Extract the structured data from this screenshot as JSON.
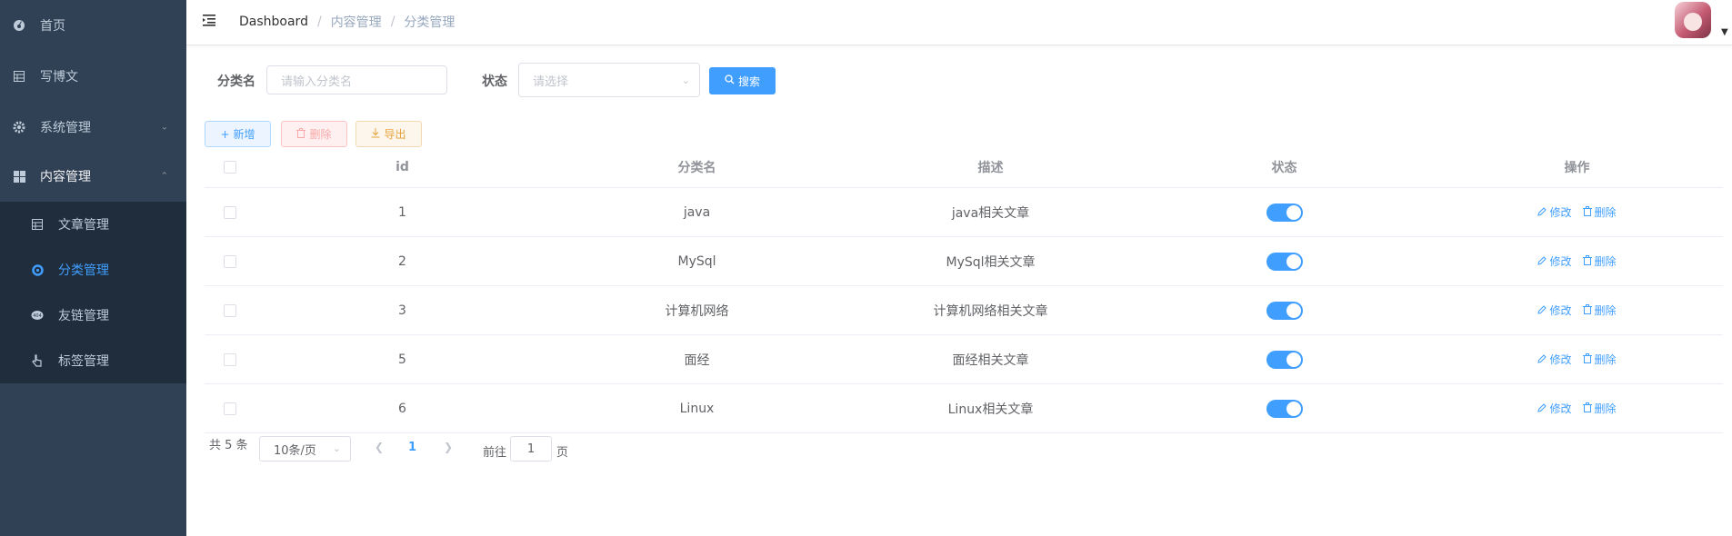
{
  "sidebar": {
    "items": [
      {
        "label": "首页",
        "icon": "dashboard-icon"
      },
      {
        "label": "写博文",
        "icon": "table-icon"
      },
      {
        "label": "系统管理",
        "icon": "gear-icon"
      },
      {
        "label": "内容管理",
        "icon": "grid-icon"
      }
    ],
    "sub_items": [
      {
        "label": "文章管理",
        "icon": "table-icon"
      },
      {
        "label": "分类管理",
        "icon": "category-icon",
        "active": true
      },
      {
        "label": "友链管理",
        "icon": "link-icon"
      },
      {
        "label": "标签管理",
        "icon": "pointer-icon"
      }
    ],
    "colors": {
      "bg": "#304156",
      "sub_bg": "#1f2d3d",
      "active": "#409eff"
    }
  },
  "header": {
    "breadcrumb": [
      "Dashboard",
      "内容管理",
      "分类管理"
    ],
    "separator": "/"
  },
  "search": {
    "name_label": "分类名",
    "name_placeholder": "请输入分类名",
    "status_label": "状态",
    "status_placeholder": "请选择",
    "search_button": "搜索"
  },
  "actions": {
    "add": "新增",
    "delete": "删除",
    "export": "导出"
  },
  "table": {
    "columns": [
      "id",
      "分类名",
      "描述",
      "状态",
      "操作"
    ],
    "rows": [
      {
        "id": "1",
        "name": "java",
        "desc": "java相关文章",
        "enabled": true
      },
      {
        "id": "2",
        "name": "MySql",
        "desc": "MySql相关文章",
        "enabled": true
      },
      {
        "id": "3",
        "name": "计算机网络",
        "desc": "计算机网络相关文章",
        "enabled": true
      },
      {
        "id": "5",
        "name": "面经",
        "desc": "面经相关文章",
        "enabled": true
      },
      {
        "id": "6",
        "name": "Linux",
        "desc": "Linux相关文章",
        "enabled": true
      }
    ],
    "edit_label": "修改",
    "delete_label": "删除"
  },
  "pagination": {
    "total_text": "共 5 条",
    "page_size": "10条/页",
    "current_page": "1",
    "goto_label": "前往",
    "goto_value": "1",
    "page_suffix": "页"
  }
}
